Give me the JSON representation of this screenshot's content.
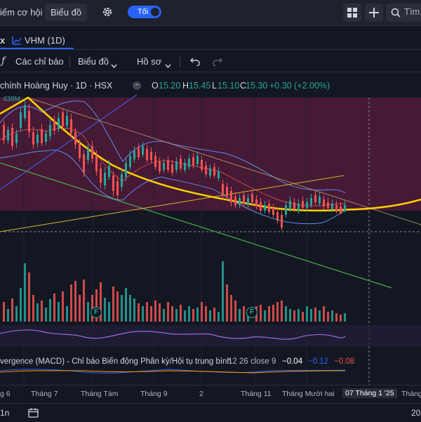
{
  "topbar": {
    "nav_basic": "iểm cơ hội",
    "nav_chart": "Biểu đồ",
    "theme_toggle": "Tối",
    "search_placeholder": "Tìm"
  },
  "tab": {
    "x_label": "x",
    "symbol": "VHM (1D)"
  },
  "toolbar": {
    "indicators": "Các chỉ báo",
    "chart": "Biểu đồ",
    "profile": "Hồ sơ"
  },
  "legend": {
    "title": "chính Hoàng Huy · 1D · HSX",
    "o_label": "O",
    "o_value": "15.20",
    "h_label": "H",
    "h_value": "15.45",
    "l_label": "L",
    "l_value": "15.10",
    "c_label": "C",
    "c_value": "15.30",
    "change": "+0.30 (+2.00%)",
    "volume_tag": "438M"
  },
  "macd": {
    "title": "vergence (MACD) - Chỉ báo Biến động Phân kỳ/Hội tụ trung bình",
    "params": "12 26 close 9",
    "v1": "−0.04",
    "v2": "−0.12",
    "v3": "−0.08"
  },
  "xaxis": {
    "labels": [
      "g 6",
      "Tháng 7",
      "Tháng Tám",
      "Tháng 9",
      "2",
      "Tháng 11",
      "Tháng Mười hai",
      "07 Tháng 1 '25",
      "Tháng"
    ]
  },
  "bottombar": {
    "range": "1n",
    "year": "20"
  },
  "events": {
    "f": "F"
  },
  "colors": {
    "up": "#26a69a",
    "down": "#ef5350",
    "accent": "#2962ff",
    "curve": "#f5d000",
    "band": "#5b8ef0",
    "pink_zone": "#5a1b3b"
  },
  "icons": [
    "fx-icon",
    "undo-icon",
    "redo-icon",
    "gear-icon",
    "grid-icon",
    "plus-icon",
    "search-icon",
    "chevron-down-icon",
    "calendar-icon",
    "chart-line-icon"
  ]
}
